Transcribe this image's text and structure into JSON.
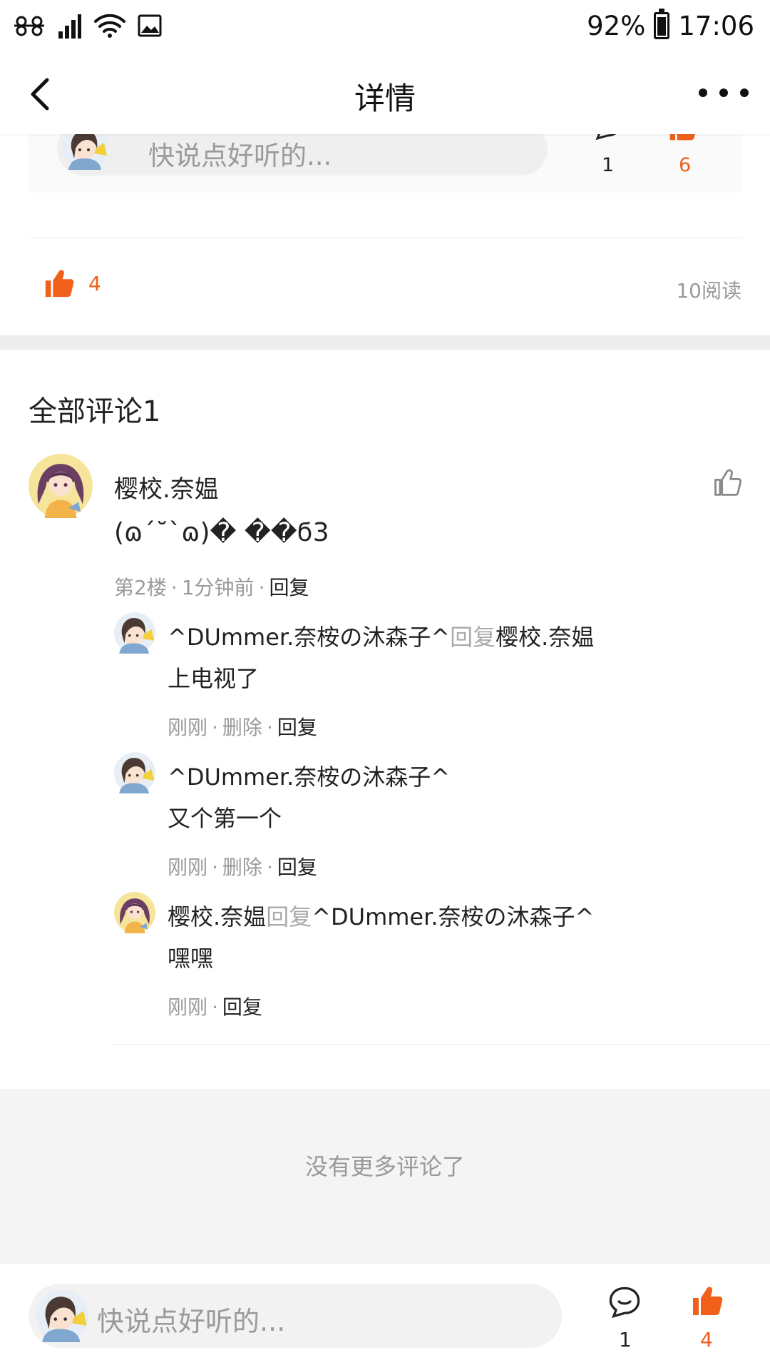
{
  "status_bar": {
    "battery": "92%",
    "time": "17:06",
    "icons": [
      "china-unicom-icon",
      "signal-icon",
      "wifi-icon",
      "image-notification-icon",
      "battery-icon"
    ]
  },
  "nav": {
    "title": "详情",
    "icons": [
      "back-arrow-icon",
      "more-icon"
    ]
  },
  "embedded_bar": {
    "placeholder": "快说点好听的...",
    "comment_count": "1",
    "like_count": "6"
  },
  "post": {
    "like_count": "4",
    "read_count": "10阅读"
  },
  "comments": {
    "section_title": "全部评论1",
    "main": {
      "author": "樱校.奈媪",
      "text": "(ɷ´˘`ɷ)� ��ϭ3",
      "floor": "第2楼",
      "time": "1分钟前",
      "reply_label": "回复"
    },
    "replies": [
      {
        "author": "^DUmmer.奈桉の沐森子^",
        "reply_word": "回复",
        "target": "樱校.奈媪",
        "text": "上电视了",
        "time": "刚刚",
        "delete_label": "删除",
        "reply_label": "回复"
      },
      {
        "author": "^DUmmer.奈桉の沐森子^",
        "text": "又个第一个",
        "time": "刚刚",
        "delete_label": "删除",
        "reply_label": "回复"
      },
      {
        "author": "樱校.奈媪",
        "reply_word": "回复",
        "target": "^DUmmer.奈桉の沐森子^",
        "text": "嘿嘿",
        "time": "刚刚",
        "reply_label": "回复"
      }
    ],
    "no_more": "没有更多评论了"
  },
  "bottom_bar": {
    "placeholder": "快说点好听的...",
    "comment_count": "1",
    "like_count": "4"
  },
  "colors": {
    "accent": "#f0601a",
    "muted": "#9a9a9a",
    "text": "#222222"
  }
}
